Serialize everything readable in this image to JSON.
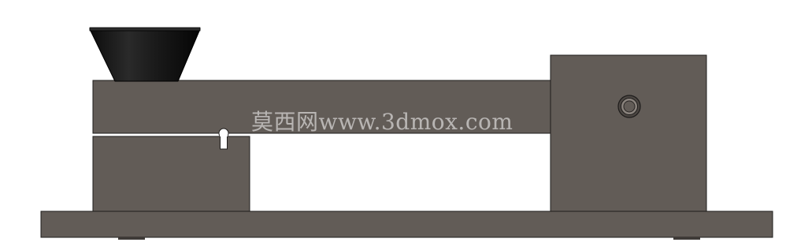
{
  "watermark": {
    "text": "莫西网www.3dmox.com"
  },
  "colors": {
    "background": "#ffffff",
    "body_fill": "#625c57",
    "body_stroke": "#1e1c1b",
    "hopper_fill": "#1f1f1f",
    "knob_ring": "#4b4642",
    "knob_inner": "#7d7671"
  }
}
